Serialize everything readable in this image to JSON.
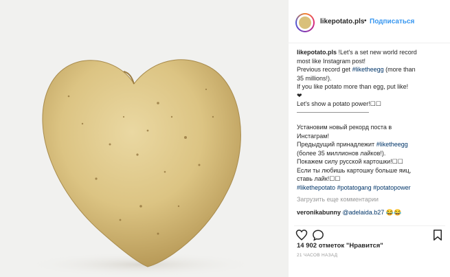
{
  "post": {
    "username": "likepotato.pls",
    "dot": "•",
    "follow_label": "Подписаться",
    "caption": {
      "username": "likepotato.pls",
      "lines": [
        "!Let's a set new world record",
        "most like Instagram post!",
        "Previous record get",
        "#liketheegg",
        "(more than",
        "35 millions!).",
        "If you like potato more than egg, put like!",
        "❤",
        "Let's show a potato power!☐☐",
        "———————————————",
        "Установим новый рекорд поста в",
        "Инстаграм!",
        "Предыдущий принадлежит",
        "#liketheegg",
        "(более 35 миллионов лайков!).",
        "Покажем силу русской картошки!☐☐",
        "Если ты любишь картошку больше яиц,",
        "ставь лайк!☐☐",
        "#likethepotato",
        "#potatogang",
        "#potatopower"
      ]
    },
    "load_more": "Загрузить еще комментарии",
    "reply": {
      "username": "veronikabunny",
      "mention": "@adelaida.b27",
      "emoji": "😂😂"
    },
    "likes_text": "14 902 отметок \"Нравится\"",
    "time_text": "21 ЧАСОВ НАЗАД",
    "icons": [
      "heart-icon",
      "comment-icon",
      "bookmark-icon"
    ]
  }
}
